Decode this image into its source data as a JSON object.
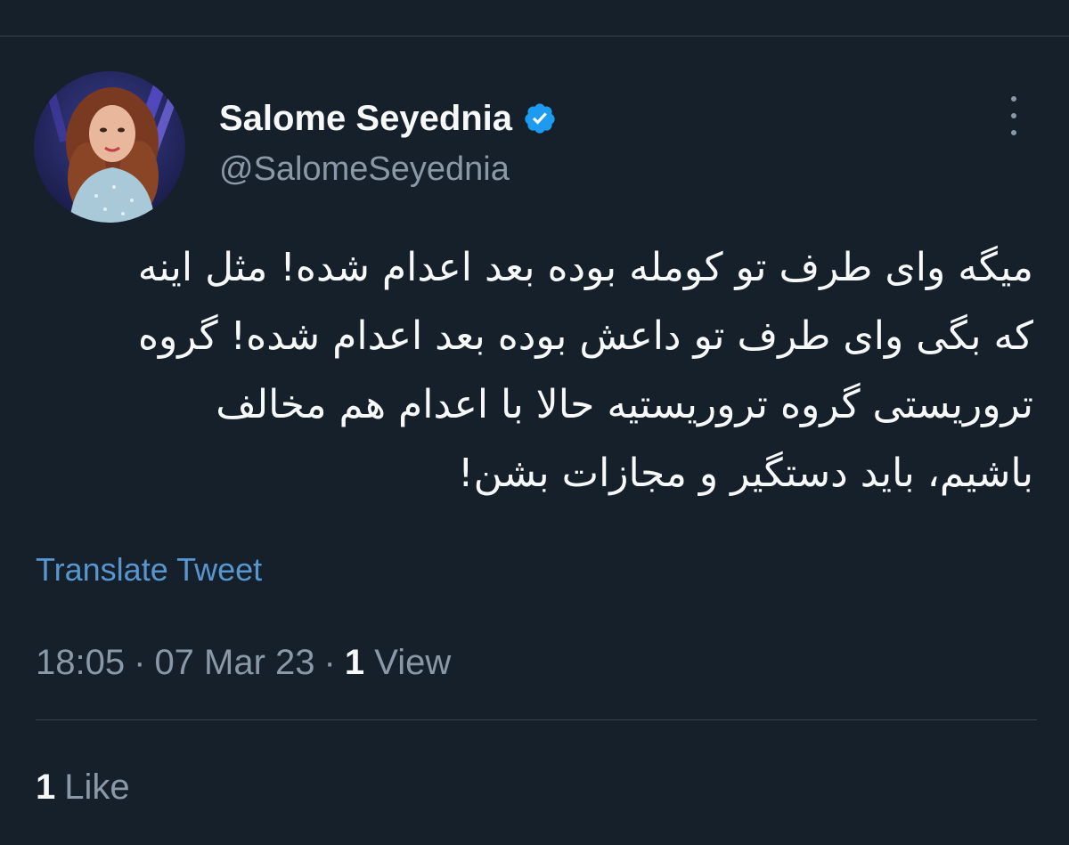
{
  "tweet": {
    "author": {
      "display_name": "Salome Seyednia",
      "handle": "@SalomeSeyednia",
      "verified": true,
      "verified_icon": "verified-badge-icon",
      "verified_color": "#1d9bf0"
    },
    "text_lines": [
      "میگه وای طرف تو کومله بوده بعد اعدام شده! مثل اینه",
      "که بگی وای طرف تو داعش بوده بعد اعدام شده! گروه",
      "تروریستی گروه تروریستیه حالا با اعدام هم مخالف",
      "باشیم، باید دستگیر و مجازات بشن!"
    ],
    "translate_label": "Translate Tweet",
    "time": "18:05",
    "date": "07 Mar 23",
    "separator": "·",
    "views_count": "1",
    "views_label": "View",
    "likes_count": "1",
    "likes_label": "Like",
    "more_icon": "more-vertical-icon"
  },
  "colors": {
    "background": "#15202b",
    "primary_text": "#f7f9f9",
    "secondary_text": "#8b98a5",
    "link": "#5896cf",
    "divider": "#38444d"
  }
}
